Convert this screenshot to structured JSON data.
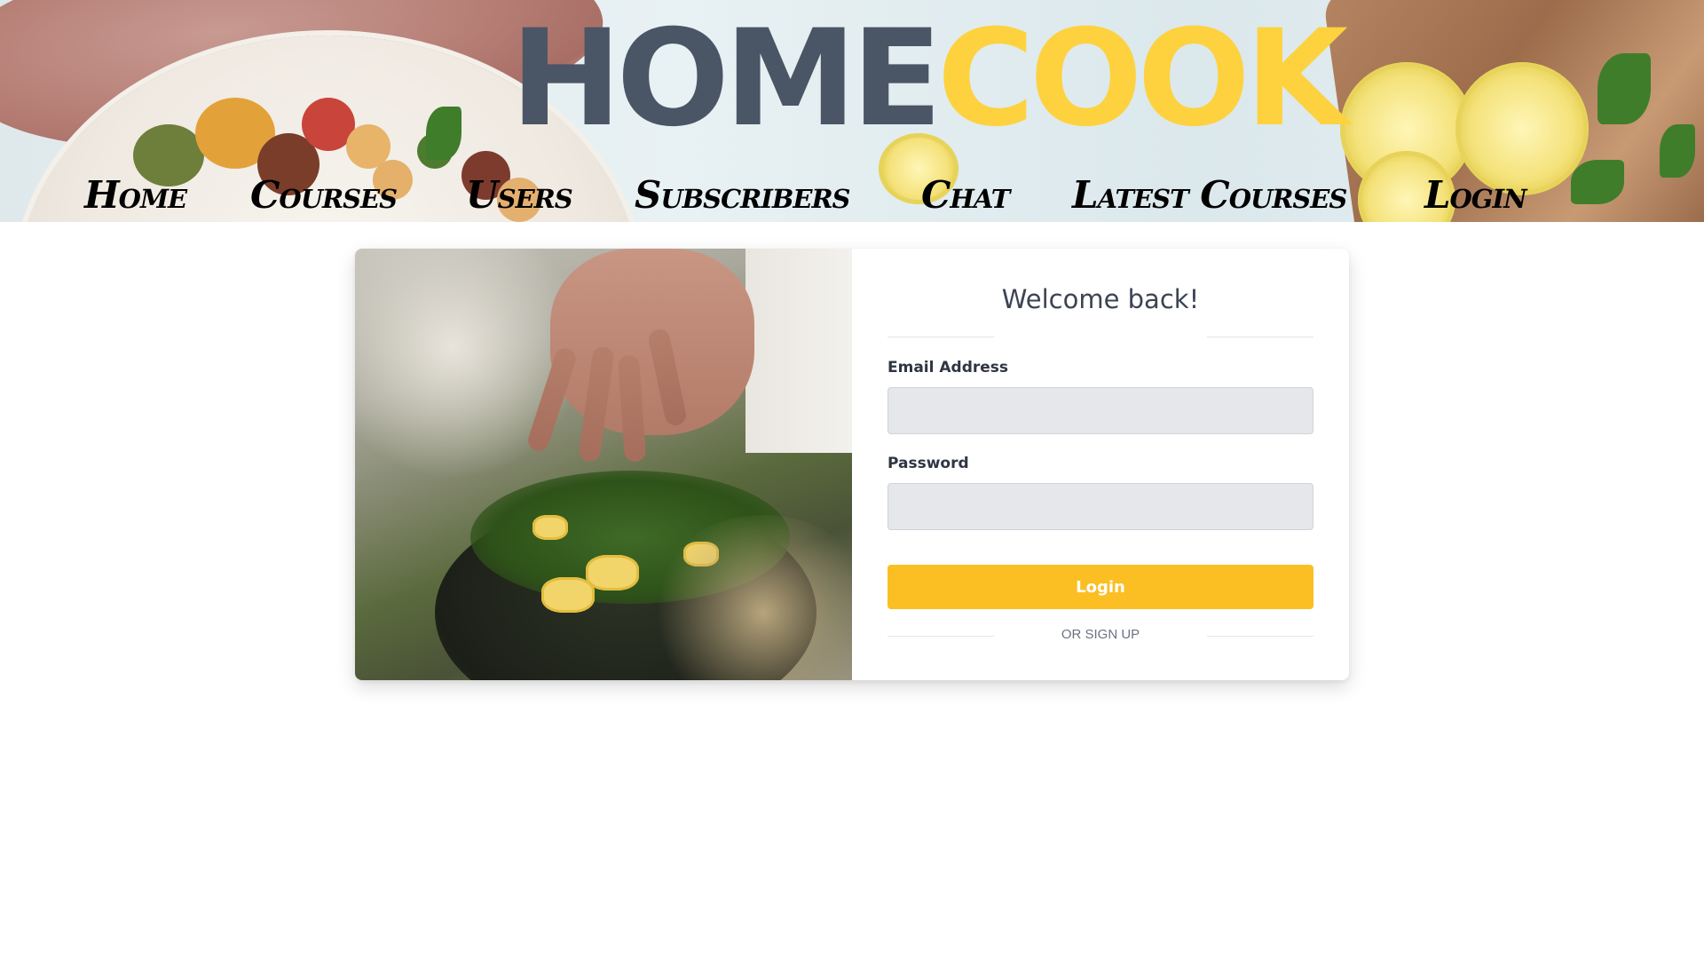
{
  "header": {
    "logo": {
      "part1": "HOME",
      "part2": "COOK"
    },
    "nav": [
      {
        "label": "Home"
      },
      {
        "label": "Courses"
      },
      {
        "label": "Users"
      },
      {
        "label": "Subscribers"
      },
      {
        "label": "Chat"
      },
      {
        "label": "Latest Courses"
      },
      {
        "label": "Login"
      }
    ]
  },
  "login": {
    "title": "Welcome back!",
    "email_label": "Email Address",
    "email_value": "",
    "password_label": "Password",
    "password_value": "",
    "submit_label": "Login",
    "signup_label": "OR SIGN UP"
  },
  "colors": {
    "logo_home": "#4a5566",
    "logo_cook": "#fdd23e",
    "button": "#fbbf24",
    "input_bg": "#e5e7eb"
  },
  "images": {
    "banner": "food-banner-image",
    "card_photo": "chef-garnishing-dish-image"
  }
}
